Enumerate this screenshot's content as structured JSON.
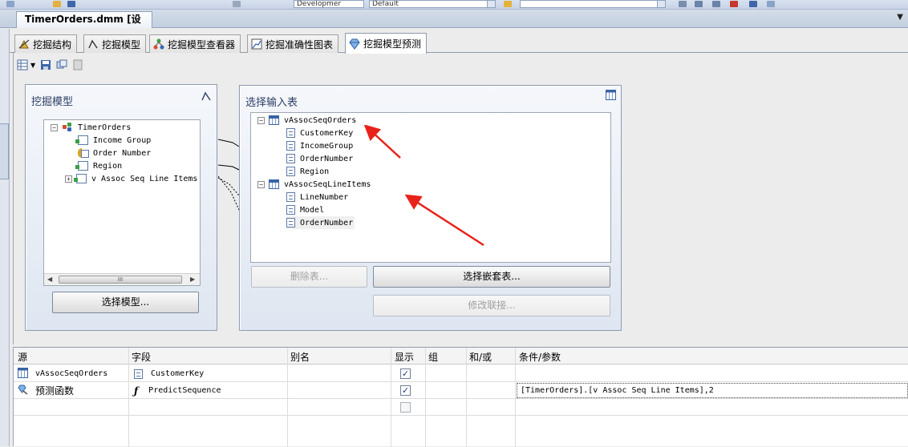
{
  "document_tab": {
    "title": "TimerOrders.dmm [设计]"
  },
  "toolbar": {
    "configuration": "Developmer",
    "platform": "Default"
  },
  "designer_tabs": [
    {
      "label": "挖掘结构",
      "icon": "mining-structure-icon"
    },
    {
      "label": "挖掘模型",
      "icon": "mining-model-icon"
    },
    {
      "label": "挖掘模型查看器",
      "icon": "model-viewer-icon"
    },
    {
      "label": "挖掘准确性图表",
      "icon": "accuracy-chart-icon"
    },
    {
      "label": "挖掘模型预测",
      "icon": "prediction-icon",
      "active": true
    }
  ],
  "model_panel": {
    "title": "挖掘模型",
    "tree": {
      "root": "TimerOrders",
      "items": [
        "Income Group",
        "Order Number",
        "Region",
        "v Assoc Seq Line Items"
      ]
    },
    "scroll_thumb": "III",
    "select_button": "选择模型..."
  },
  "input_panel": {
    "title": "选择输入表",
    "tables": [
      {
        "name": "vAssocSeqOrders",
        "columns": [
          "CustomerKey",
          "IncomeGroup",
          "OrderNumber",
          "Region"
        ]
      },
      {
        "name": "vAssocSeqLineItems",
        "columns": [
          "LineNumber",
          "Model",
          "OrderNumber"
        ]
      }
    ],
    "delete_button": "删除表...",
    "nested_button": "选择嵌套表...",
    "join_button": "修改联接..."
  },
  "grid": {
    "headers": [
      "源",
      "字段",
      "别名",
      "显示",
      "组",
      "和/或",
      "条件/参数"
    ],
    "rows": [
      {
        "source": "vAssocSeqOrders",
        "field": "CustomerKey",
        "alias": "",
        "show": true,
        "criteria": ""
      },
      {
        "source": "预测函数",
        "field": "PredictSequence",
        "alias": "",
        "show": true,
        "criteria": "[TimerOrders].[v Assoc Seq Line Items],2"
      },
      {
        "source": "",
        "field": "",
        "alias": "",
        "show": false,
        "criteria": ""
      }
    ]
  },
  "colors": {
    "annotation_arrow": "#e8221b",
    "panel_title": "#2d3f66"
  }
}
